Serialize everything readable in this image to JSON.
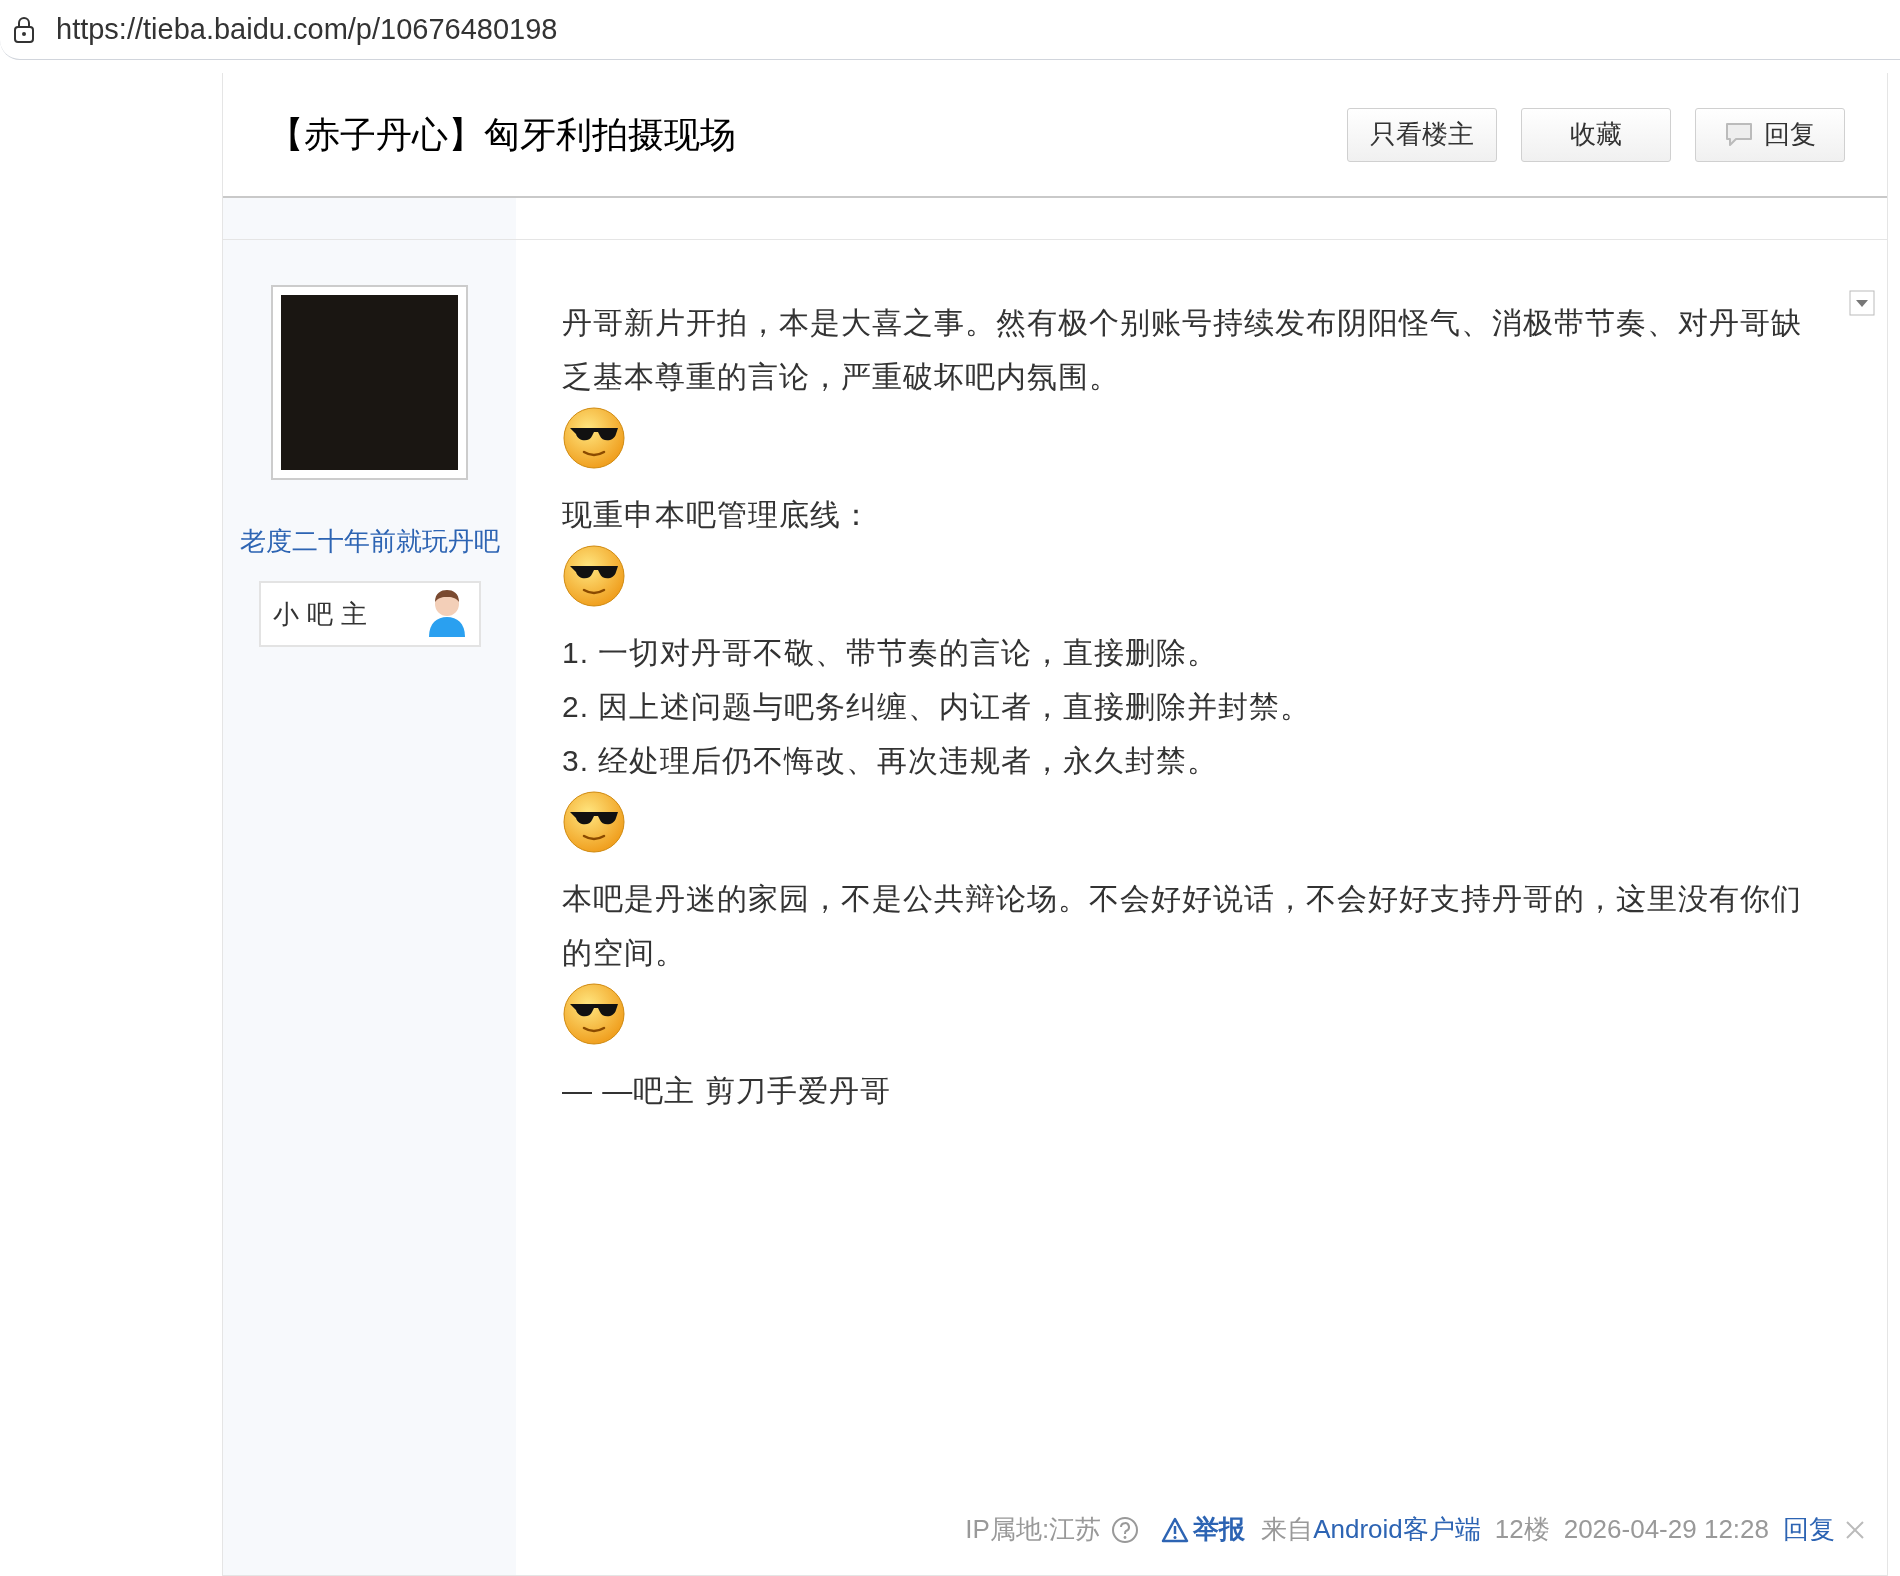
{
  "address_bar": {
    "url": "https://tieba.baidu.com/p/10676480198"
  },
  "thread": {
    "title": "【赤子丹心】匈牙利拍摄现场",
    "buttons": [
      "只看楼主",
      "收藏",
      "回复"
    ]
  },
  "post": {
    "author": {
      "name": "老度二十年前就玩丹吧",
      "badge": "小 吧 主"
    },
    "content": [
      {
        "kind": "text",
        "text": "丹哥新片开拍，本是大喜之事。然有极个别账号持续发布阴阳怪气、消极带节奏、对丹哥缺乏基本尊重的言论，严重破坏吧内氛围。"
      },
      {
        "kind": "emoji"
      },
      {
        "kind": "text",
        "text": "现重申本吧管理底线："
      },
      {
        "kind": "emoji"
      },
      {
        "kind": "text",
        "text": "1. 一切对丹哥不敬、带节奏的言论，直接删除。"
      },
      {
        "kind": "text",
        "text": "2. 因上述问题与吧务纠缠、内讧者，直接删除并封禁。"
      },
      {
        "kind": "text",
        "text": "3. 经处理后仍不悔改、再次违规者，永久封禁。"
      },
      {
        "kind": "emoji"
      },
      {
        "kind": "text",
        "text": "本吧是丹迷的家园，不是公共辩论场。不会好好说话，不会好好支持丹哥的，这里没有你们的空间。"
      },
      {
        "kind": "emoji"
      },
      {
        "kind": "text",
        "text": "— —吧主 剪刀手爱丹哥"
      }
    ],
    "footer": {
      "ip": "IP属地:江苏",
      "report": "举报",
      "source_prefix": "来自",
      "source_link": "Android客户端",
      "floor": "12楼",
      "time": "2026-04-29 12:28",
      "reply": "回复"
    }
  }
}
